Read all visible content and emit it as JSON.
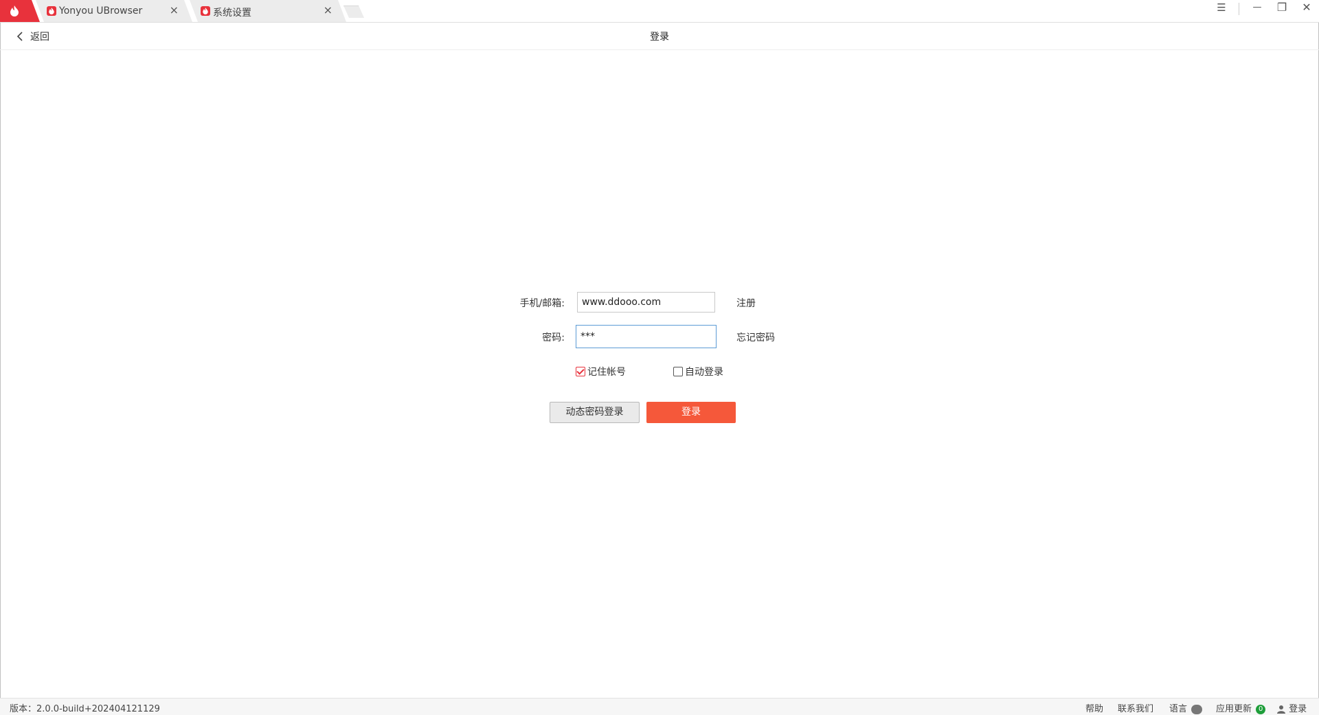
{
  "tabs": [
    {
      "label": "Yonyou UBrowser",
      "close": "×"
    },
    {
      "label": "系统设置",
      "close": "×"
    }
  ],
  "window": {
    "menu": "☰",
    "minimize": "—",
    "restore": "❐",
    "close": "✕"
  },
  "header": {
    "back_label": "返回",
    "title": "登录"
  },
  "form": {
    "account_label": "手机/邮箱:",
    "account_value": "www.ddooo.com",
    "register_link": "注册",
    "password_label": "密码:",
    "password_value": "***",
    "forgot_link": "忘记密码",
    "remember_label": "记住帐号",
    "remember_checked": true,
    "autologin_label": "自动登录",
    "autologin_checked": false,
    "dynamic_login_button": "动态密码登录",
    "login_button": "登录"
  },
  "status": {
    "version": "版本：2.0.0-build+202404121129",
    "help": "帮助",
    "contact": "联系我们",
    "language": "语言",
    "updates": "应用更新",
    "update_count": "0",
    "login": "登录"
  },
  "colors": {
    "brand": "#e8323c",
    "primary_button": "#f5583a",
    "focus_border": "#5b9bd5",
    "badge": "#1e9e3a"
  },
  "icons": [
    "ubrowser-logo-icon",
    "chevron-left-icon",
    "menu-icon",
    "minimize-icon",
    "restore-icon",
    "close-icon",
    "globe-icon",
    "user-icon",
    "checkbox-icon"
  ]
}
